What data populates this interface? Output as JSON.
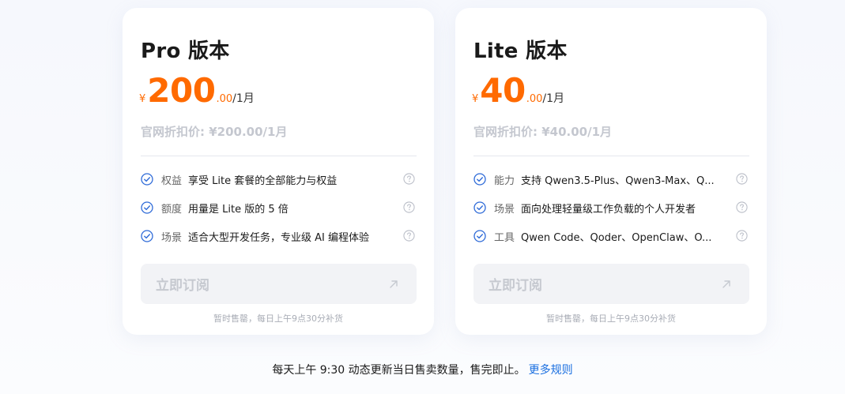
{
  "colors": {
    "accent_orange": "#ff6a00",
    "check_blue": "#2f6bd8",
    "link_blue": "#1a6fe0",
    "muted_gray": "#c4c7cf"
  },
  "plans": [
    {
      "title": "Pro 版本",
      "price": {
        "currency": "¥",
        "amount": "200",
        "decimal": ".00",
        "period": "/1月"
      },
      "official_price": "官网折扣价: ¥200.00/1月",
      "features": [
        {
          "icon": "check-circle-icon",
          "label": "权益",
          "text": "享受 Lite 套餐的全部能力与权益",
          "help_icon": "question-circle-icon"
        },
        {
          "icon": "check-circle-icon",
          "label": "额度",
          "text": "用量是 Lite 版的 5 倍",
          "help_icon": "question-circle-icon"
        },
        {
          "icon": "check-circle-icon",
          "label": "场景",
          "text": "适合大型开发任务，专业级 AI 编程体验",
          "help_icon": "question-circle-icon"
        }
      ],
      "subscribe_label": "立即订阅",
      "subscribe_icon": "arrow-up-right-icon",
      "sold_out_note": "暂时售罄，每日上午9点30分补货"
    },
    {
      "title": "Lite 版本",
      "price": {
        "currency": "¥",
        "amount": "40",
        "decimal": ".00",
        "period": "/1月"
      },
      "official_price": "官网折扣价: ¥40.00/1月",
      "features": [
        {
          "icon": "check-circle-icon",
          "label": "能力",
          "text": "支持 Qwen3.5-Plus、Qwen3-Max、Q...",
          "help_icon": "question-circle-icon"
        },
        {
          "icon": "check-circle-icon",
          "label": "场景",
          "text": "面向处理轻量级工作负载的个人开发者",
          "help_icon": "question-circle-icon"
        },
        {
          "icon": "check-circle-icon",
          "label": "工具",
          "text": "Qwen Code、Qoder、OpenClaw、O...",
          "help_icon": "question-circle-icon"
        }
      ],
      "subscribe_label": "立即订阅",
      "subscribe_icon": "arrow-up-right-icon",
      "sold_out_note": "暂时售罄，每日上午9点30分补货"
    }
  ],
  "footer": {
    "text": "每天上午 9:30 动态更新当日售卖数量，售完即止。",
    "link_label": "更多规则"
  }
}
